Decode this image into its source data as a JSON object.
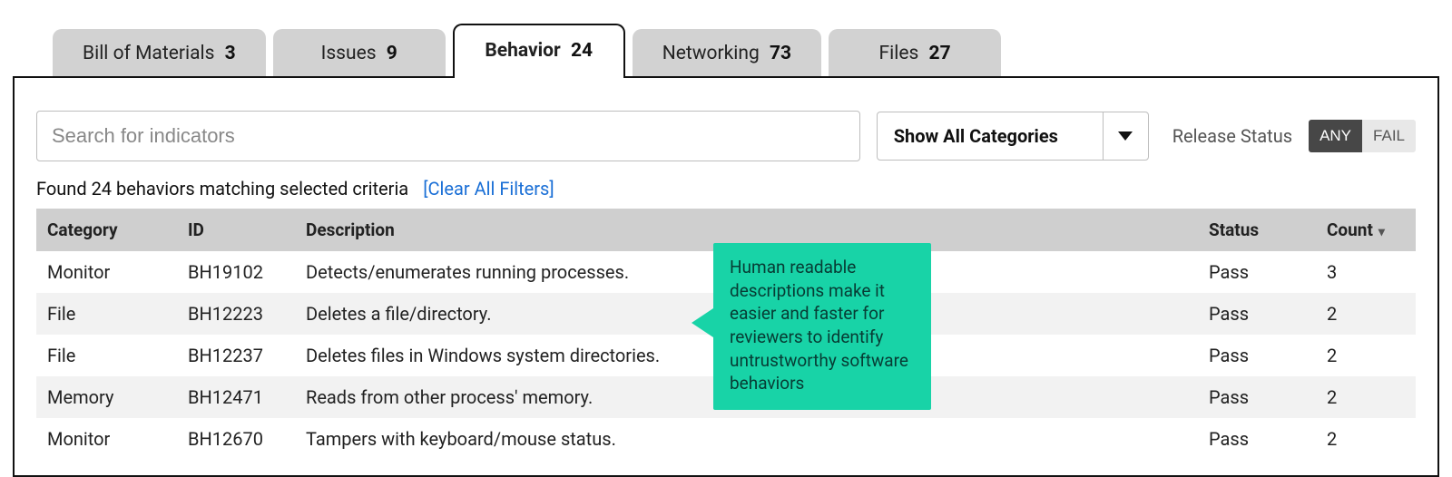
{
  "tabs": [
    {
      "label": "Bill of Materials",
      "count": "3",
      "active": false
    },
    {
      "label": "Issues",
      "count": "9",
      "active": false
    },
    {
      "label": "Behavior",
      "count": "24",
      "active": true
    },
    {
      "label": "Networking",
      "count": "73",
      "active": false
    },
    {
      "label": "Files",
      "count": "27",
      "active": false
    }
  ],
  "filters": {
    "search_placeholder": "Search for indicators",
    "category_dropdown": "Show All Categories",
    "release_status_label": "Release Status",
    "toggle_any": "ANY",
    "toggle_fail": "FAIL"
  },
  "results": {
    "summary": "Found 24 behaviors matching selected criteria",
    "clear_link": "[Clear All Filters]"
  },
  "columns": {
    "category": "Category",
    "id": "ID",
    "description": "Description",
    "status": "Status",
    "count": "Count"
  },
  "rows": [
    {
      "category": "Monitor",
      "id": "BH19102",
      "description": "Detects/enumerates running processes.",
      "status": "Pass",
      "count": "3"
    },
    {
      "category": "File",
      "id": "BH12223",
      "description": "Deletes a file/directory.",
      "status": "Pass",
      "count": "2"
    },
    {
      "category": "File",
      "id": "BH12237",
      "description": "Deletes files in Windows system directories.",
      "status": "Pass",
      "count": "2"
    },
    {
      "category": "Memory",
      "id": "BH12471",
      "description": "Reads from other process' memory.",
      "status": "Pass",
      "count": "2"
    },
    {
      "category": "Monitor",
      "id": "BH12670",
      "description": "Tampers with keyboard/mouse status.",
      "status": "Pass",
      "count": "2"
    }
  ],
  "callout": {
    "text": "Human readable descriptions make it easier and faster for reviewers to identify untrustworthy software behaviors"
  }
}
